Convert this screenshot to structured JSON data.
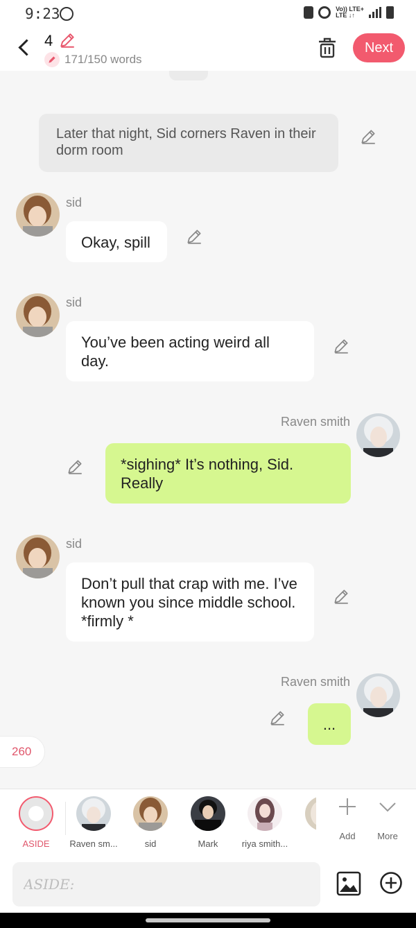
{
  "status_bar": {
    "time": "9:23",
    "volte_label": "Vo)) LTE+\nLTE ↓↑"
  },
  "header": {
    "part_number": "4",
    "word_count": "171/150 words",
    "next_label": "Next"
  },
  "messages": [
    {
      "type": "narration",
      "text": "Later that night, Sid corners Raven in their dorm room"
    },
    {
      "type": "left",
      "speaker": "sid",
      "text": "Okay, spill"
    },
    {
      "type": "left",
      "speaker": "sid",
      "text": "You’ve been acting weird all day."
    },
    {
      "type": "right",
      "speaker": "Raven smith",
      "text": "*sighing* It’s nothing, Sid. Really"
    },
    {
      "type": "left",
      "speaker": "sid",
      "text": "Don’t pull that crap with me. I’ve known you since middle school. *firmly *"
    },
    {
      "type": "right",
      "speaker": "Raven smith",
      "text": "..."
    }
  ],
  "counter": "260",
  "characters": [
    {
      "label": "ASIDE",
      "active": true
    },
    {
      "label": "Raven sm..."
    },
    {
      "label": "sid"
    },
    {
      "label": "Mark"
    },
    {
      "label": "riya smith..."
    }
  ],
  "actions": {
    "add_label": "Add",
    "more_label": "More"
  },
  "input": {
    "placeholder": "ASIDE:"
  },
  "colors": {
    "accent": "#f25a6e",
    "right_bubble": "#d6f790",
    "left_bubble": "#ffffff",
    "narration_bg": "#eaeaea"
  }
}
